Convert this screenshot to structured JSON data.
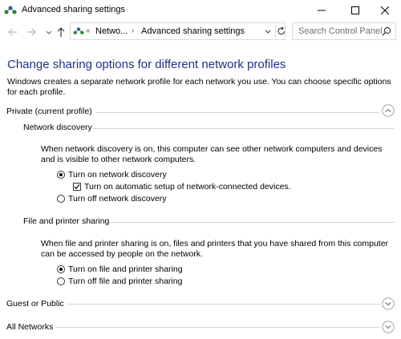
{
  "window": {
    "title": "Advanced sharing settings"
  },
  "address_bar": {
    "chevron": "«",
    "crumbs": [
      "Netwo...",
      "Advanced sharing settings"
    ],
    "separator": "›"
  },
  "search": {
    "placeholder": "Search Control Panel"
  },
  "main": {
    "heading": "Change sharing options for different network profiles",
    "description": "Windows creates a separate network profile for each network you use. You can choose specific options for each profile."
  },
  "private_profile": {
    "label": "Private (current profile)",
    "network_discovery": {
      "label": "Network discovery",
      "description": "When network discovery is on, this computer can see other network computers and devices and is visible to other network computers.",
      "options": {
        "turn_on": {
          "label": "Turn on network discovery",
          "selected": true
        },
        "auto_setup": {
          "label": "Turn on automatic setup of network-connected devices.",
          "checked": true
        },
        "turn_off": {
          "label": "Turn off network discovery",
          "selected": false
        }
      }
    },
    "file_printer_sharing": {
      "label": "File and printer sharing",
      "description": "When file and printer sharing is on, files and printers that you have shared from this computer can be accessed by people on the network.",
      "options": {
        "turn_on": {
          "label": "Turn on file and printer sharing",
          "selected": true
        },
        "turn_off": {
          "label": "Turn off file and printer sharing",
          "selected": false
        }
      }
    }
  },
  "guest_profile": {
    "label": "Guest or Public"
  },
  "all_networks": {
    "label": "All Networks"
  },
  "colors": {
    "heading": "#1e3287",
    "divider": "#d4d4d4",
    "icon_green": "#2e8b3e",
    "icon_blue": "#2b6cb8"
  }
}
